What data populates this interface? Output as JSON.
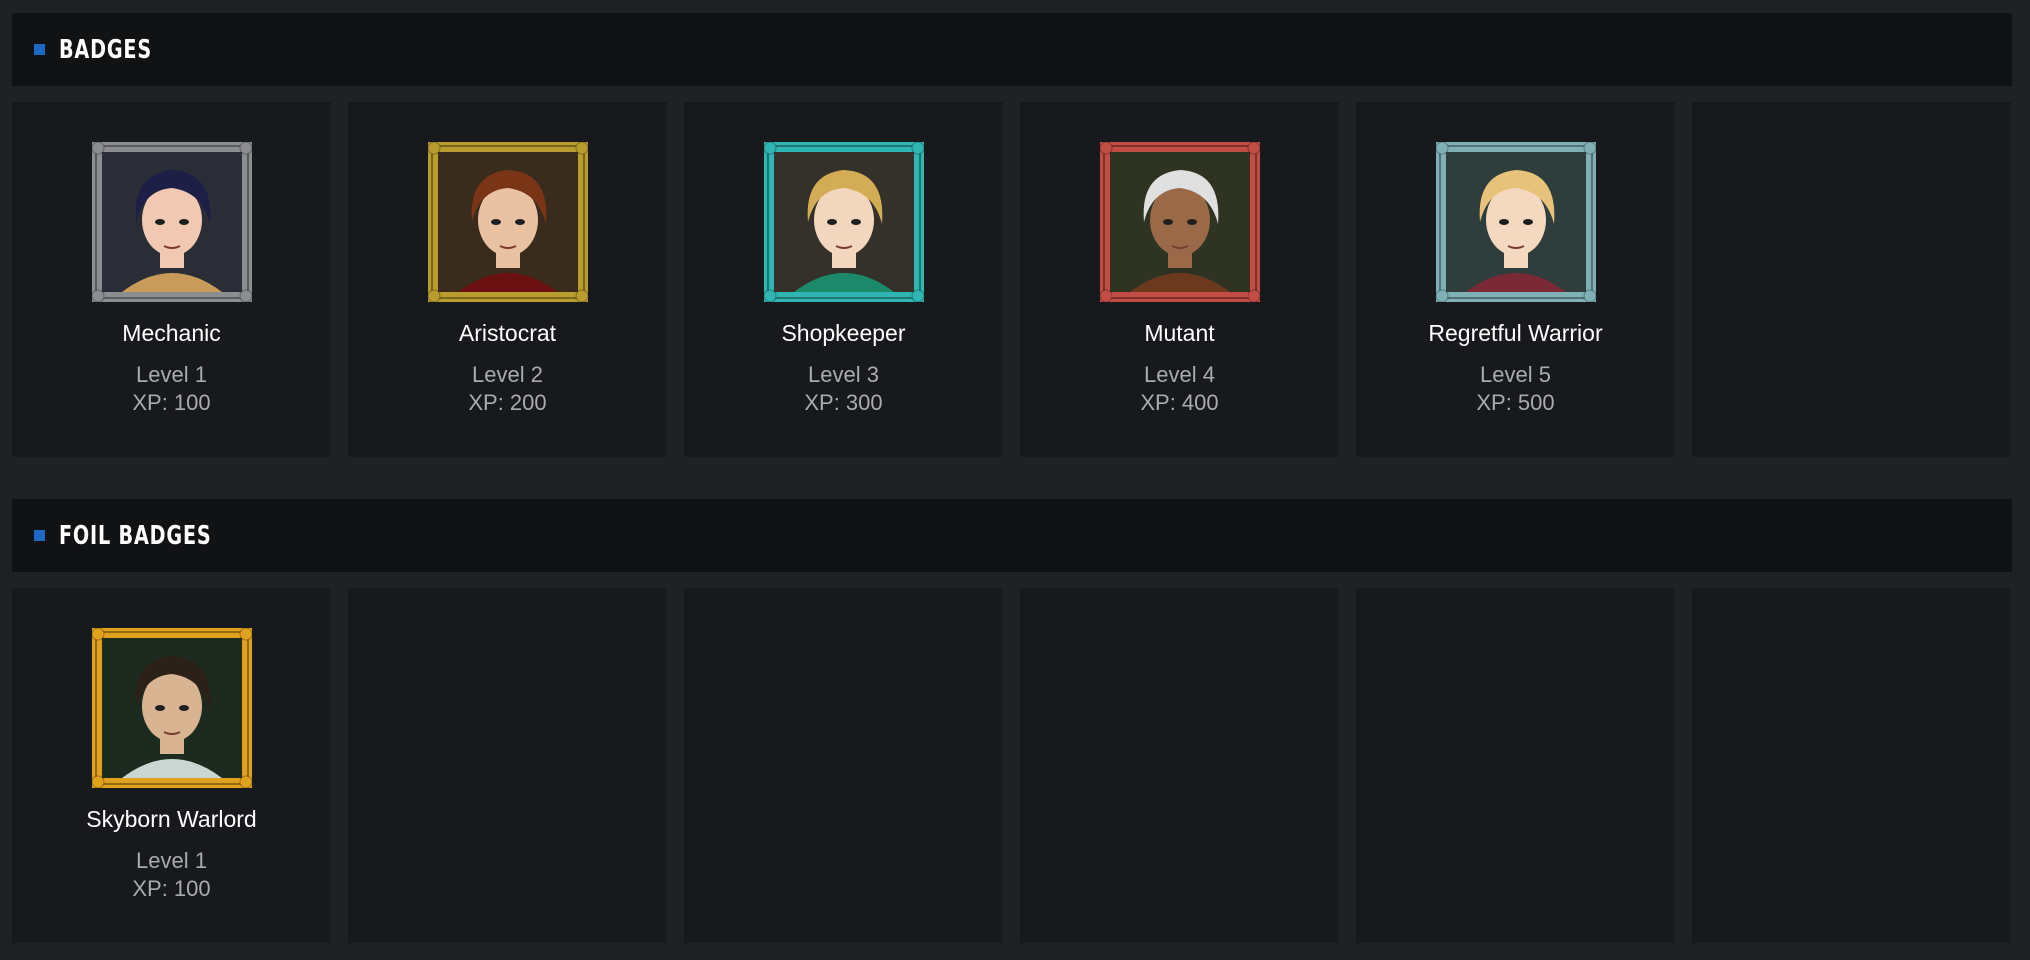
{
  "sections": [
    {
      "title": "BADGES",
      "cards": [
        {
          "name": "Mechanic",
          "level": "Level 1",
          "xp": "XP: 100",
          "frame": "#8b8d90",
          "hair": "#1d1f46",
          "skin": "#f1c9b2",
          "bg": "#2a2c36",
          "accent": "#c79c5b",
          "icon": "mechanic-portrait-icon"
        },
        {
          "name": "Aristocrat",
          "level": "Level 2",
          "xp": "XP: 200",
          "frame": "#b89d2e",
          "hair": "#7a3516",
          "skin": "#e9c2a4",
          "bg": "#3a2c1c",
          "accent": "#6b1010",
          "icon": "aristocrat-portrait-icon"
        },
        {
          "name": "Shopkeeper",
          "level": "Level 3",
          "xp": "XP: 300",
          "frame": "#2fb5b2",
          "hair": "#d3ad55",
          "skin": "#f3d6be",
          "bg": "#34312a",
          "accent": "#1c8a6a",
          "icon": "shopkeeper-portrait-icon"
        },
        {
          "name": "Mutant",
          "level": "Level 4",
          "xp": "XP: 400",
          "frame": "#c24d44",
          "hair": "#e0e0e0",
          "skin": "#9a6a48",
          "bg": "#2e3322",
          "accent": "#6b3a1e",
          "icon": "mutant-portrait-icon"
        },
        {
          "name": "Regretful Warrior",
          "level": "Level 5",
          "xp": "XP: 500",
          "frame": "#7fb0b6",
          "hair": "#e7c27a",
          "skin": "#f4d8c0",
          "bg": "#2f3e3c",
          "accent": "#7a2a36",
          "icon": "regretful-warrior-portrait-icon"
        },
        null
      ]
    },
    {
      "title": "FOIL BADGES",
      "cards": [
        {
          "name": "Skyborn Warlord",
          "level": "Level 1",
          "xp": "XP: 100",
          "frame": "#e0a21c",
          "hair": "#2b2118",
          "skin": "#d9b493",
          "bg": "#1d2a20",
          "accent": "#c9d6d2",
          "icon": "skyborn-warlord-portrait-icon"
        },
        null,
        null,
        null,
        null,
        null
      ]
    }
  ]
}
